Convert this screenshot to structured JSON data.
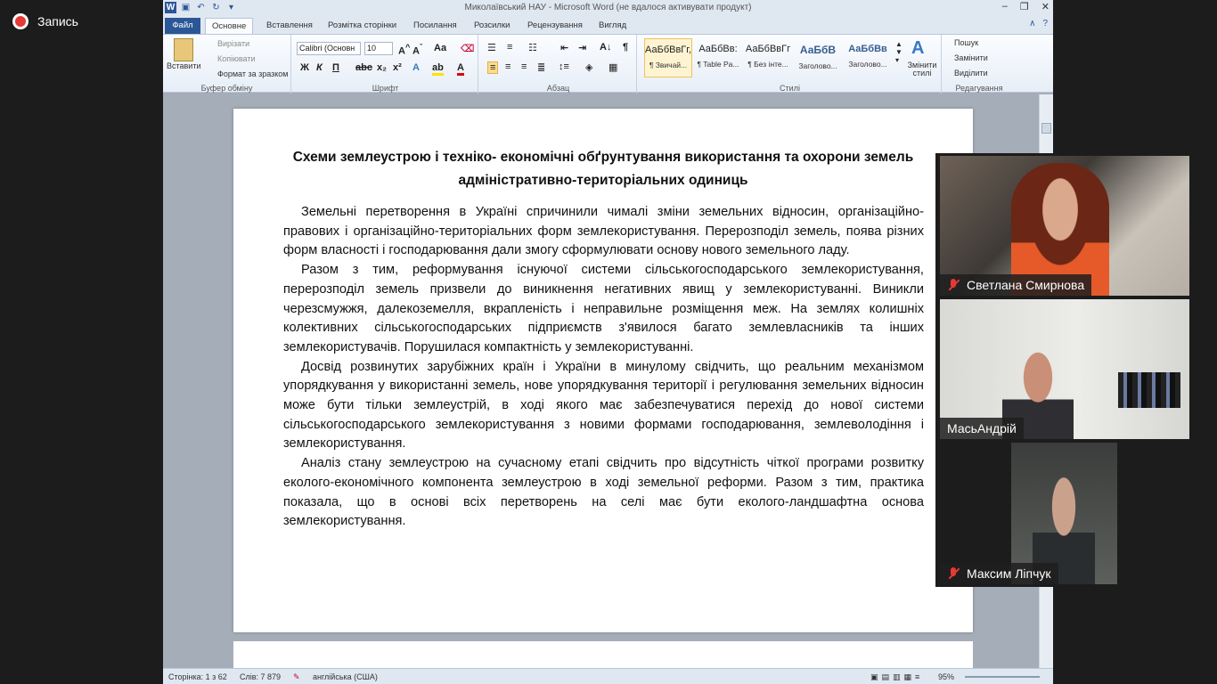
{
  "recording": {
    "label": "Запись"
  },
  "window": {
    "title": "Миколаївський НАУ  -  Microsoft Word (не вдалося активувати продукт)"
  },
  "tabs": [
    "Файл",
    "Основне",
    "Вставлення",
    "Розмітка сторінки",
    "Посилання",
    "Розсилки",
    "Рецензування",
    "Вигляд"
  ],
  "ribbon": {
    "clipboard": {
      "paste": "Вставити",
      "cut": "Вирізати",
      "copy": "Копіювати",
      "format_painter": "Формат за зразком",
      "label": "Буфер обміну"
    },
    "font": {
      "name": "Calibri (Основн",
      "size": "10",
      "label": "Шрифт"
    },
    "paragraph": {
      "label": "Абзац"
    },
    "styles": {
      "label": "Стилі",
      "items": [
        {
          "sample": "АаБбВвГг,",
          "name": "¶ Звичай..."
        },
        {
          "sample": "АаБбВв:",
          "name": "¶ Table Pa..."
        },
        {
          "sample": "АаБбВвГг",
          "name": "¶ Без інте..."
        },
        {
          "sample": "АаБбВ",
          "name": "Заголово..."
        },
        {
          "sample": "АаБбВв",
          "name": "Заголово..."
        }
      ],
      "change": "Змінити стилі"
    },
    "editing": {
      "find": "Пошук",
      "replace": "Замінити",
      "select": "Виділити",
      "label": "Редагування"
    }
  },
  "document": {
    "title": "Схеми землеустрою і техніко- економічні обґрунтування використання та охорони земель адміністративно-територіальних  одиниць",
    "paragraphs": [
      "Земельні перетворення в Україні спричинили чималі зміни земельних відносин, організаційно-правових і організаційно-територіальних форм землекористування. Перерозподіл земель, поява різних форм власності і господарювання дали змогу сформулювати основу нового земельного ладу.",
      "Разом з тим, реформування існуючої системи сільськогосподарського землекористування, перерозподіл земель призвели до виникнення негативних явищ у землекористуванні. Виникли черезсмужжя, далекоземелля, вкрапленість і неправильне розміщення меж. На землях колишніх колективних сільськогосподарських підприємств з'явилося багато землевласників та інших землекористувачів. Порушилася компактність у землекористуванні.",
      "Досвід розвинутих зарубіжних країн і України в минулому свідчить, що реальним механізмом упорядкування у використанні земель, нове упорядкування території і регулювання земельних відносин може бути тільки землеустрій, в ході якого має забезпечуватися перехід до нової системи сільськогосподарського землекористування з новими формами господарювання, землеволодіння і землекористування.",
      "Аналіз стану землеустрою на сучасному етапі свідчить про відсутність чіткої програми розвитку еколого-економічного компонента землеустрою в ході земельної реформи. Разом з тим, практика показала, що в основі всіх перетворень на селі має бути еколого-ландшафтна основа землекористування."
    ]
  },
  "status": {
    "page": "Сторінка: 1 з 62",
    "words": "Слів: 7 879",
    "language": "англійська (США)",
    "zoom": "95%"
  },
  "participants": [
    {
      "name": "Светлана Смирнова",
      "muted": true
    },
    {
      "name": "МасьАндрій",
      "muted": false
    },
    {
      "name": "Максим Ліпчук",
      "muted": true
    }
  ]
}
